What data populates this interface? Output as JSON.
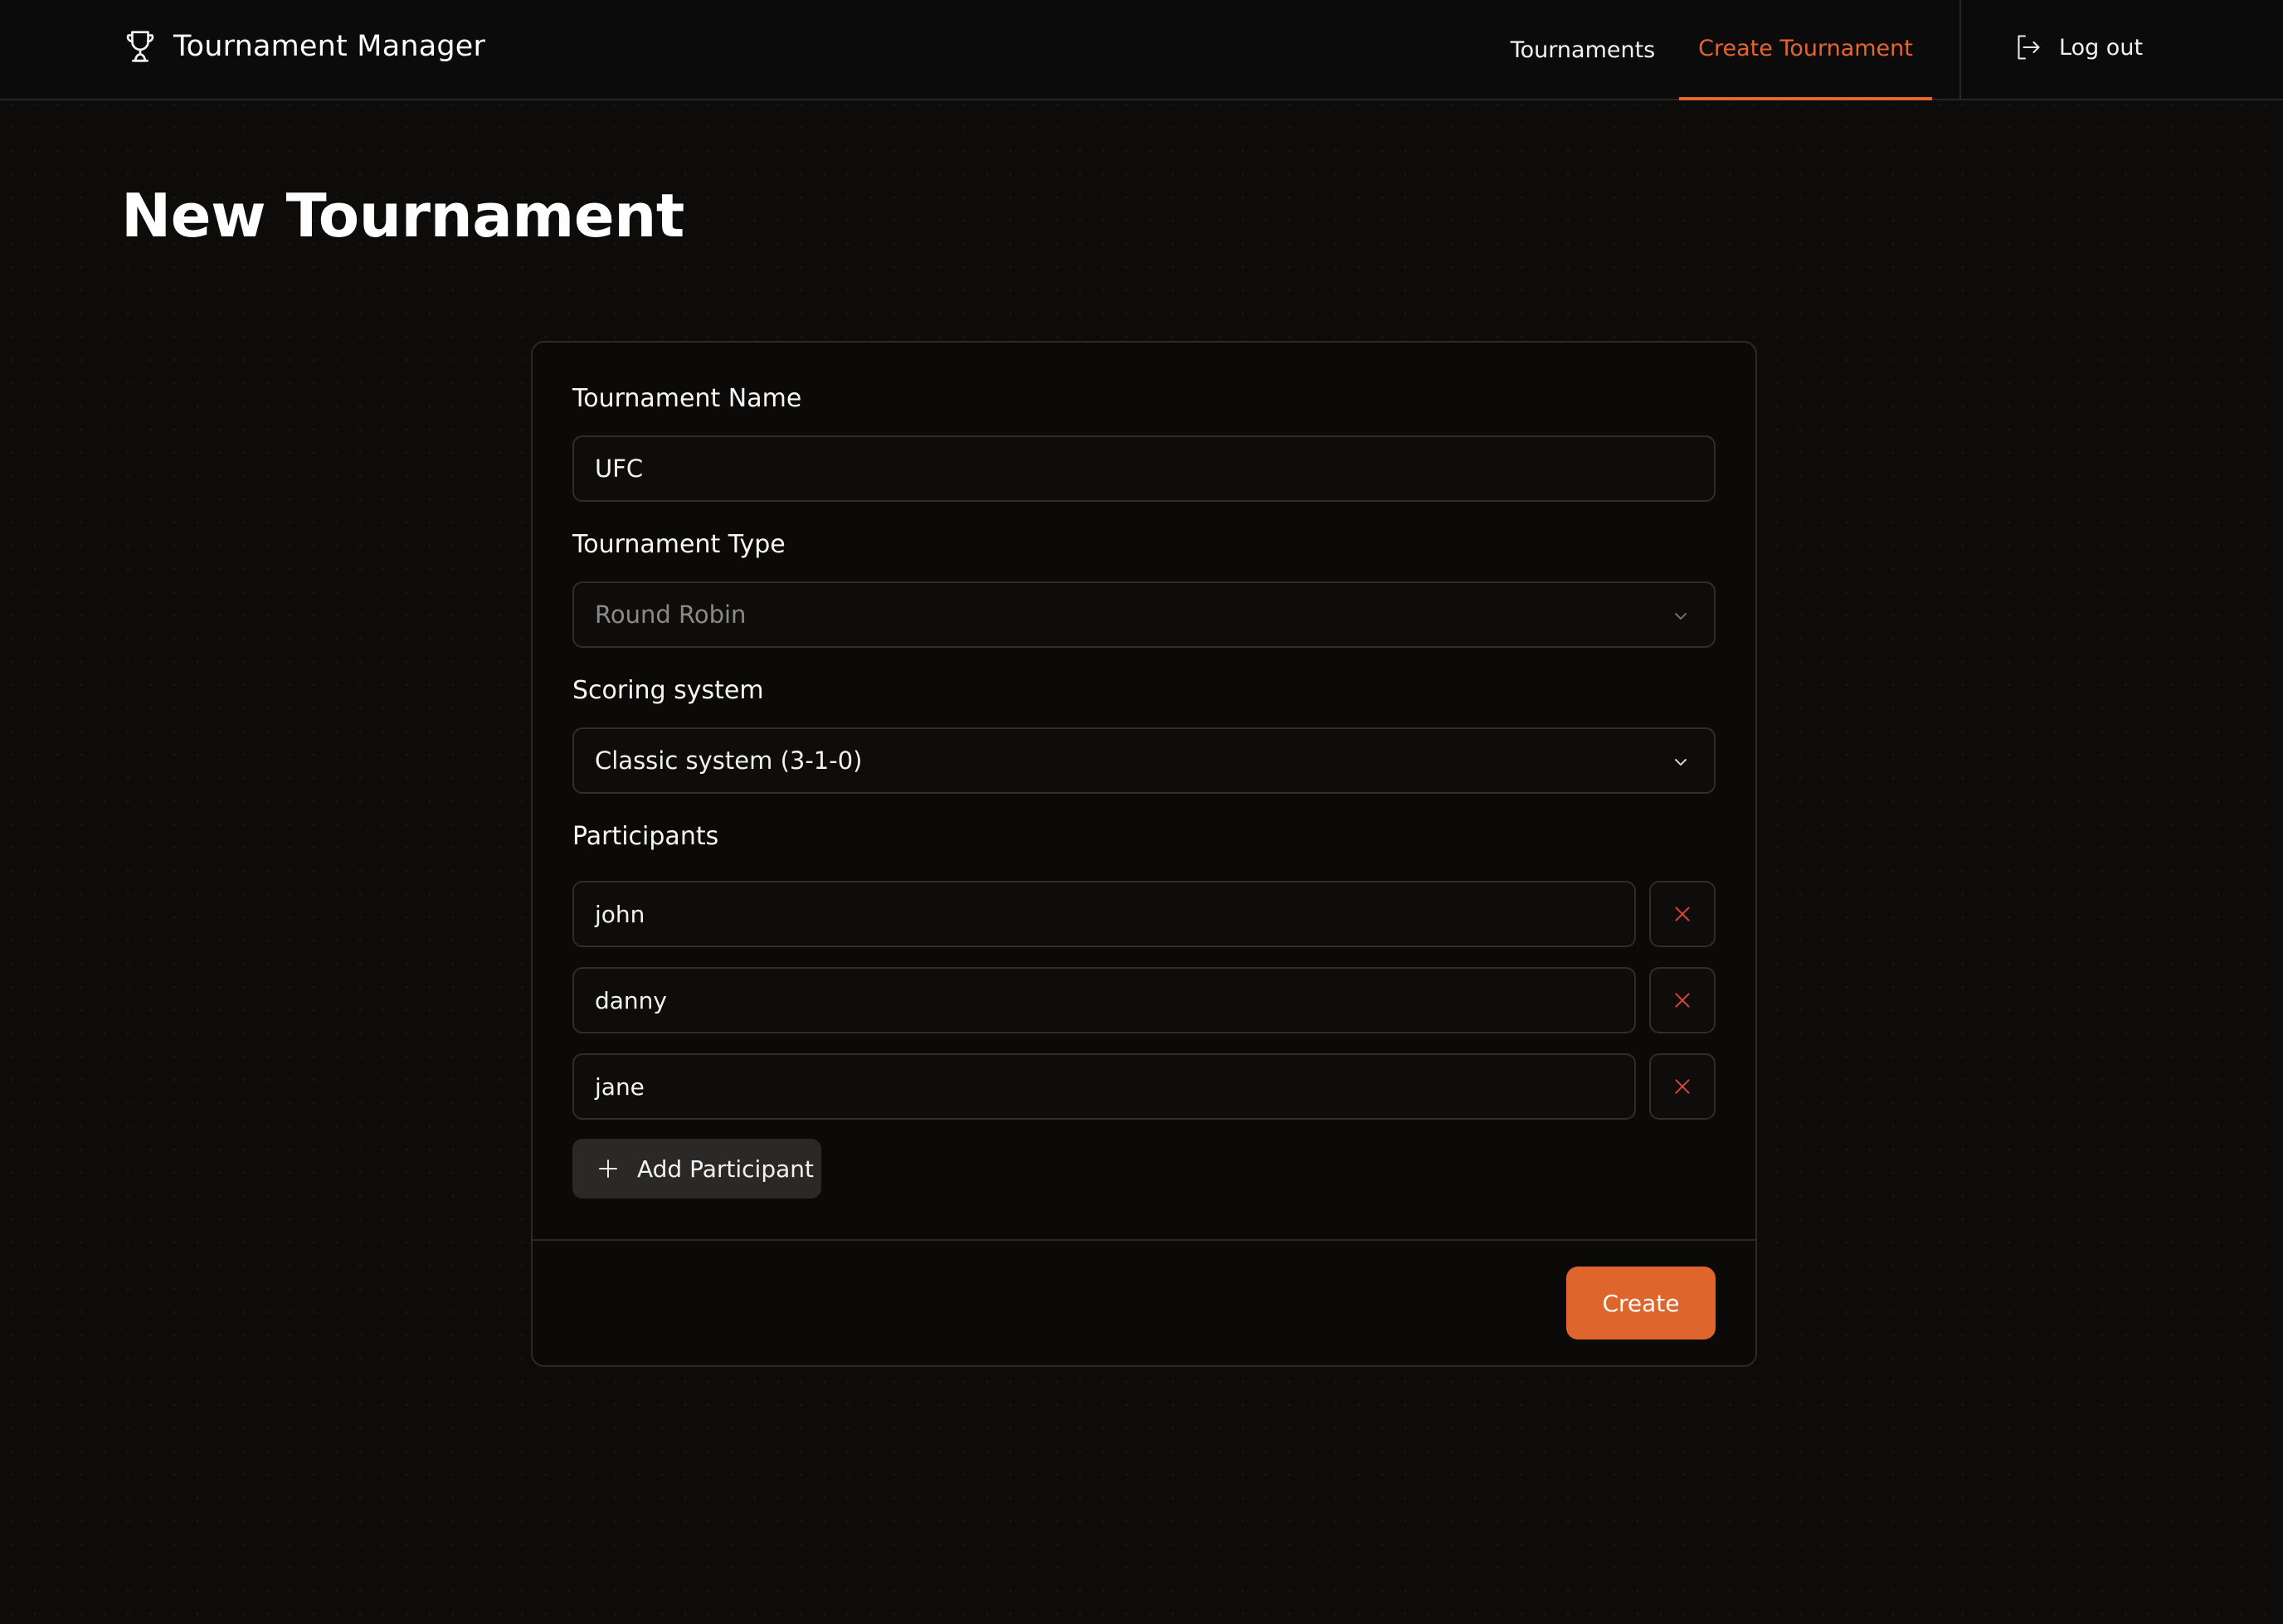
{
  "header": {
    "brand_icon": "trophy-icon",
    "brand_name": "Tournament Manager",
    "nav": [
      {
        "label": "Tournaments",
        "active": false
      },
      {
        "label": "Create Tournament",
        "active": true
      }
    ],
    "logout_icon": "logout-icon",
    "logout_label": "Log out"
  },
  "page": {
    "title": "New Tournament"
  },
  "form": {
    "name_label": "Tournament Name",
    "name_value": "UFC",
    "type_label": "Tournament Type",
    "type_value": "Round Robin",
    "type_disabled": true,
    "scoring_label": "Scoring system",
    "scoring_value": "Classic system (3-1-0)",
    "participants_label": "Participants",
    "participants": [
      "john",
      "danny",
      "jane"
    ],
    "remove_icon": "close-icon",
    "add_participant_label": "Add Participant",
    "add_icon": "plus-icon",
    "submit_label": "Create"
  },
  "colors": {
    "accent": "#de652c",
    "nav_active": "#e4662f",
    "remove_icon": "#d9453a",
    "background": "#0d0c0b"
  }
}
